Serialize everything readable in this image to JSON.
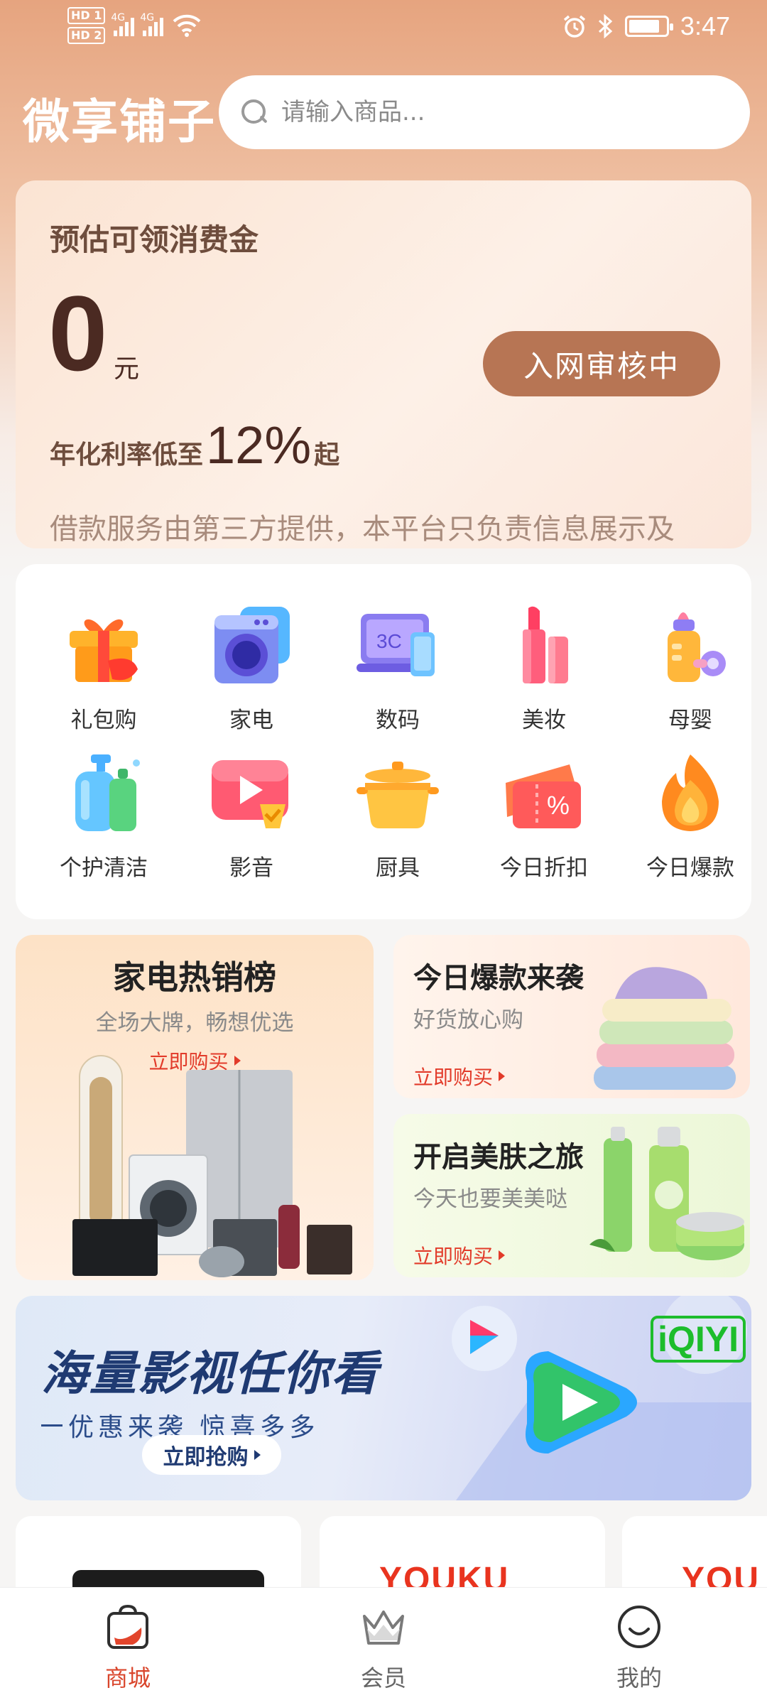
{
  "status_bar": {
    "sim1": "HD 1",
    "sim2": "HD 2",
    "net1": "4G",
    "net2": "4G",
    "battery_level": 0.85,
    "time": "3:47"
  },
  "header": {
    "brand": "微享铺子",
    "search_placeholder": "请输入商品..."
  },
  "credit": {
    "title": "预估可领消费金",
    "amount": "0",
    "unit": "元",
    "status_button": "入网审核中",
    "rate_prefix": "年化利率低至",
    "rate_value": "12%",
    "rate_suffix": "起",
    "note": "借款服务由第三方提供，本平台只负责信息展示及"
  },
  "categories": [
    {
      "label": "礼包购",
      "icon": "gift-icon"
    },
    {
      "label": "家电",
      "icon": "washing-machine-icon"
    },
    {
      "label": "数码",
      "icon": "laptop-3c-icon"
    },
    {
      "label": "美妆",
      "icon": "lipstick-icon"
    },
    {
      "label": "母婴",
      "icon": "baby-bottle-icon"
    },
    {
      "label": "个护清洁",
      "icon": "cleaning-bottle-icon"
    },
    {
      "label": "影音",
      "icon": "video-play-icon"
    },
    {
      "label": "厨具",
      "icon": "cooking-pot-icon"
    },
    {
      "label": "今日折扣",
      "icon": "discount-ticket-icon"
    },
    {
      "label": "今日爆款",
      "icon": "flame-icon"
    }
  ],
  "promos": {
    "appliance": {
      "title": "家电热销榜",
      "subtitle": "全场大牌，畅想优选",
      "cta": "立即购买"
    },
    "hot": {
      "title": "今日爆款来袭",
      "subtitle": "好货放心购",
      "cta": "立即购买"
    },
    "beauty": {
      "title": "开启美肤之旅",
      "subtitle": "今天也要美美哒",
      "cta": "立即购买"
    }
  },
  "video_banner": {
    "title": "海量影视任你看",
    "subtitle": "优惠来袭 惊喜多多",
    "cta": "立即抢购",
    "brand": "iQIYI"
  },
  "brands": [
    "YOUKU",
    "YOU"
  ],
  "tabbar": [
    {
      "label": "商城",
      "icon": "shop-bag-icon",
      "active": true
    },
    {
      "label": "会员",
      "icon": "crown-icon",
      "active": false
    },
    {
      "label": "我的",
      "icon": "smile-face-icon",
      "active": false
    }
  ],
  "colors": {
    "accent": "#d9452b",
    "brown": "#b77554",
    "cta_red": "#e23b2a"
  }
}
